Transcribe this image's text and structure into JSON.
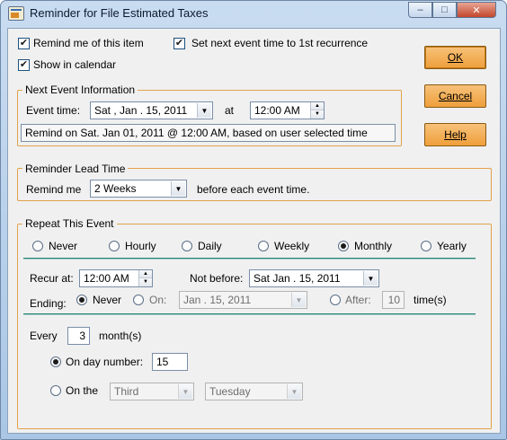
{
  "window": {
    "title": "Reminder for File Estimated Taxes",
    "min_symbol": "–",
    "max_symbol": "□",
    "close_symbol": "✕"
  },
  "options": {
    "remind_label": "Remind me of this item",
    "remind_checked": true,
    "set_next_label": "Set next event time to 1st recurrence",
    "set_next_checked": true,
    "show_calendar_label": "Show in calendar",
    "show_calendar_checked": true
  },
  "buttons": {
    "ok": "OK",
    "cancel": "Cancel",
    "help": "Help"
  },
  "next_event": {
    "group_title": "Next Event Information",
    "event_time_label": "Event time:",
    "date_value": "Sat  ,  Jan . 15, 2011",
    "at_label": "at",
    "time_value": "12:00 AM",
    "summary": "Remind on Sat. Jan 01, 2011 @ 12:00 AM, based on user selected time"
  },
  "lead_time": {
    "group_title": "Reminder Lead Time",
    "remind_me_label": "Remind me",
    "selected": "2 Weeks",
    "suffix": "before each event time."
  },
  "repeat": {
    "group_title": "Repeat This Event",
    "frequencies": [
      "Never",
      "Hourly",
      "Daily",
      "Weekly",
      "Monthly",
      "Yearly"
    ],
    "selected_frequency": "Monthly",
    "recur_at_label": "Recur at:",
    "recur_at_value": "12:00 AM",
    "not_before_label": "Not before:",
    "not_before_value": "Sat   Jan . 15, 2011",
    "ending_label": "Ending:",
    "ending_never_label": "Never",
    "ending_on_label": "On:",
    "ending_on_value": "Jan . 15, 2011",
    "ending_after_label": "After:",
    "ending_after_value": "10",
    "times_label": "time(s)",
    "selected_ending": "Never",
    "every_label": "Every",
    "every_value": "3",
    "month_label": "month(s)",
    "on_day_number_label": "On day number:",
    "day_number_value": "15",
    "on_the_label": "On the",
    "ordinal_value": "Third",
    "weekday_value": "Tuesday",
    "selected_day_mode": "day_number"
  },
  "icons": {
    "check": "✔",
    "dropdown": "▼",
    "spin_up": "▲",
    "spin_down": "▼"
  }
}
